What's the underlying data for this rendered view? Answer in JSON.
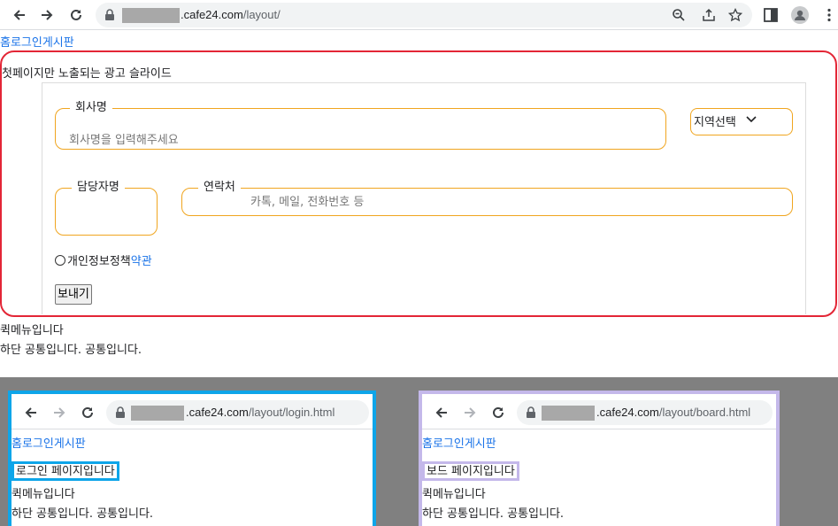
{
  "browser": {
    "url_host_suffix": ".cafe24.com",
    "url_path": "/layout/"
  },
  "header": {
    "nav_links": "홈로그인게시판"
  },
  "ad": {
    "title": "첫페이지만 노출되는 광고 슬라이드",
    "company_legend": "회사명",
    "company_placeholder": "회사명을 입력해주세요",
    "region_select": "지역선택",
    "manager_legend": "담당자명",
    "contact_legend": "연락처",
    "contact_placeholder": "카톡, 메일, 전화번호 등",
    "privacy_label": "개인정보정책",
    "privacy_link": "약관",
    "send_button": "보내기"
  },
  "quick_menu": "퀵메뉴입니다",
  "footer": "하단 공통입니다. 공통입니다.",
  "login_panel": {
    "url_host_suffix": ".cafe24.com",
    "url_path": "/layout/login.html",
    "nav_links": "홈로그인게시판",
    "page_label": "로그인 페이지입니다",
    "quick_menu": "퀵메뉴입니다",
    "footer": "하단 공통입니다. 공통입니다."
  },
  "board_panel": {
    "url_host_suffix": ".cafe24.com",
    "url_path": "/layout/board.html",
    "nav_links": "홈로그인게시판",
    "page_label": "보드 페이지입니다",
    "quick_menu": "퀵메뉴입니다",
    "footer": "하단 공통입니다. 공통입니다."
  },
  "colors": {
    "ad_outline": "#e32636",
    "field_border": "#f0a51f",
    "login_outline": "#0ea5e9",
    "board_outline": "#c4b8ea",
    "link": "#1a73e8"
  },
  "icons": [
    "back-icon",
    "forward-icon",
    "reload-icon",
    "lock-icon",
    "zoom-icon",
    "share-icon",
    "star-icon",
    "sidepanel-icon",
    "profile-icon",
    "menu-icon",
    "chevron-down-icon"
  ]
}
